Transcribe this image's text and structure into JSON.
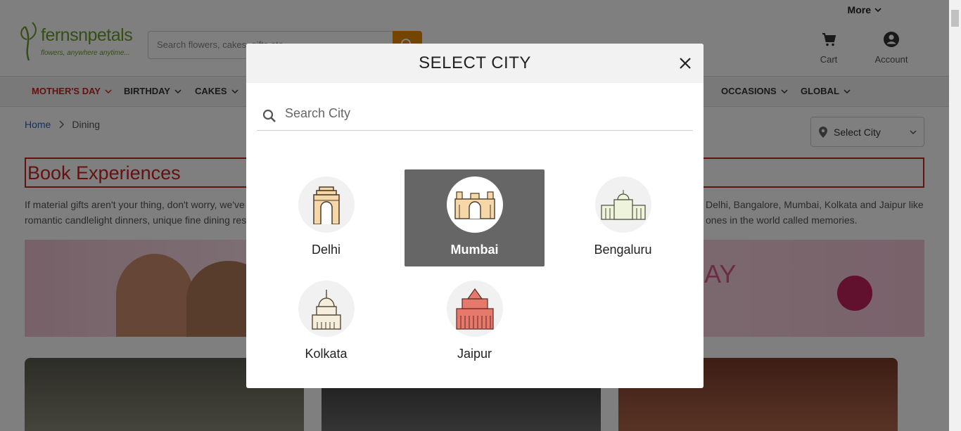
{
  "header": {
    "more_label": "More",
    "logo_brand": "fernsnpetals",
    "logo_tagline": "flowers, anywhere anytime...",
    "search_placeholder": "Search flowers, cakes, gifts etc",
    "cart_label": "Cart",
    "account_label": "Account"
  },
  "nav": {
    "items": [
      {
        "label": "MOTHER'S DAY"
      },
      {
        "label": "BIRTHDAY"
      },
      {
        "label": "CAKES"
      },
      {
        "label": "OCCASIONS"
      },
      {
        "label": "GLOBAL"
      }
    ]
  },
  "breadcrumb": {
    "home": "Home",
    "current": "Dining"
  },
  "select_city_label": "Select City",
  "page": {
    "heading": "Book Experiences",
    "desc_left_1": "If material gifts aren't your thing, don't worry, we've",
    "desc_left_2": "romantic candlelight dinners, unique fine dining res",
    "desc_right_1": "Delhi, Bangalore, Mumbai, Kolkata and Jaipur like",
    "desc_right_2": "ones in the world called memories.",
    "banner_text": "AY"
  },
  "modal": {
    "title": "SELECT CITY",
    "search_placeholder": "Search City",
    "cities": [
      {
        "name": "Delhi",
        "icon": "india-gate-icon"
      },
      {
        "name": "Mumbai",
        "icon": "gateway-of-india-icon",
        "selected": true
      },
      {
        "name": "Bengaluru",
        "icon": "vidhana-soudha-icon"
      },
      {
        "name": "Kolkata",
        "icon": "victoria-memorial-icon"
      },
      {
        "name": "Jaipur",
        "icon": "hawa-mahal-icon"
      }
    ]
  },
  "colors": {
    "accent_red": "#cc2222",
    "search_button": "#e88a00",
    "selected_city_bg": "#666666"
  }
}
